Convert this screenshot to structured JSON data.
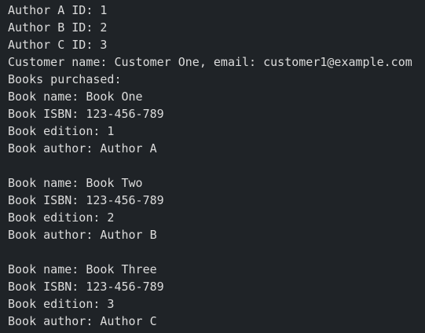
{
  "output_lines": [
    "Author A ID: 1",
    "Author B ID: 2",
    "Author C ID: 3",
    "Customer name: Customer One, email: customer1@example.com",
    "Books purchased:",
    "Book name: Book One",
    "Book ISBN: 123-456-789",
    "Book edition: 1",
    "Book author: Author A",
    "",
    "Book name: Book Two",
    "Book ISBN: 123-456-789",
    "Book edition: 2",
    "Book author: Author B",
    "",
    "Book name: Book Three",
    "Book ISBN: 123-456-789",
    "Book edition: 3",
    "Book author: Author C"
  ],
  "colors": {
    "background": "#1f2327",
    "text": "#dcdcdc"
  }
}
